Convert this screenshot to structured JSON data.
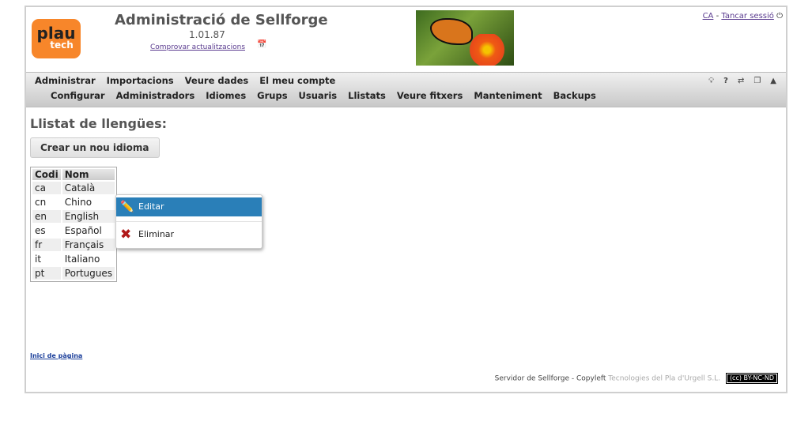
{
  "header": {
    "logo_text": "plau",
    "logo_sub": "tech",
    "title": "Administració de Sellforge",
    "version": "1.01.87",
    "check_updates": "Comprovar actualitzacions",
    "lang": "CA",
    "separator": "-",
    "logout": "Tancar sessió"
  },
  "nav": {
    "row1": [
      "Administrar",
      "Importacions",
      "Veure dades",
      "El meu compte"
    ],
    "row2": [
      "Configurar",
      "Administradors",
      "Idiomes",
      "Grups",
      "Usuaris",
      "Llistats",
      "Veure fitxers",
      "Manteniment",
      "Backups"
    ],
    "tools": [
      "lightbulb-icon",
      "help-icon",
      "swap-icon",
      "window-icon",
      "collapse-icon"
    ]
  },
  "main": {
    "heading": "Llistat de llengües:",
    "new_button": "Crear un nou idioma",
    "table": {
      "headers": [
        "Codi",
        "Nom"
      ],
      "rows": [
        [
          "ca",
          "Català"
        ],
        [
          "cn",
          "Chino"
        ],
        [
          "en",
          "English"
        ],
        [
          "es",
          "Español"
        ],
        [
          "fr",
          "Français"
        ],
        [
          "it",
          "Italiano"
        ],
        [
          "pt",
          "Portugues"
        ]
      ]
    },
    "context_menu": [
      {
        "label": "Editar",
        "icon": "pencil-icon"
      },
      {
        "label": "Eliminar",
        "icon": "delete-x-icon"
      }
    ]
  },
  "footer": {
    "top_link": "Inici de pàgina",
    "server": "Servidor de Sellforge - Copyleft",
    "company": "Tecnologies del Pla d'Urgell S.L.",
    "license": "(cc) BY-NC-ND"
  },
  "colors": {
    "accent": "#2a7fb8",
    "logo": "#f7862a"
  }
}
